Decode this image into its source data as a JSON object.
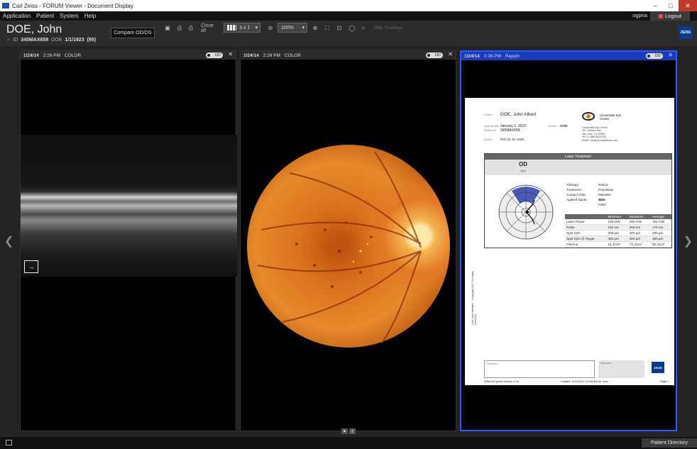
{
  "window": {
    "title": "Carl Zeiss - FORUM Viewer - Document Display",
    "minimize": "–",
    "maximize": "□",
    "close": "✕"
  },
  "menu": {
    "items": [
      "Application",
      "Patient",
      "System",
      "Help"
    ],
    "user": "ogpna",
    "logout": "Logout"
  },
  "patient": {
    "name": "DOE, John",
    "id_label": "ID",
    "id": "345MAX658",
    "dob_label": "DOB",
    "dob": "1/1/1923",
    "age": "(95)"
  },
  "toolbar": {
    "compare": "Compare OD/OS",
    "close_all": "Close all",
    "layout": "3 x 1",
    "zoom": "100%",
    "hide_overlays": "Hide Overlays"
  },
  "panels": [
    {
      "date": "1/24/14",
      "time": "2:26 PM",
      "type": "COLOR",
      "eye": "OD",
      "close": "✕"
    },
    {
      "date": "1/24/14",
      "time": "2:26 PM",
      "type": "COLOR",
      "eye": "OD",
      "close": "✕"
    },
    {
      "date": "1/24/14",
      "time": "2:26 PM",
      "type": "Report",
      "eye": "OD",
      "close": "✕"
    }
  ],
  "report": {
    "patient_label": "Patient",
    "patient_name": "DOE, John Albert",
    "dob_label": "Date of Birth",
    "dob": "January 1, 1923",
    "id_label": "Patient ID",
    "id": "345MAX658",
    "sex_label": "Gender",
    "sex": "male",
    "doctor_label": "Doctor",
    "doctor": "Prof. Dr. Dr. Smith",
    "clinic_name": "Cloverdale Eye Center",
    "clinic_address": [
      "Cloverdale Eye Center",
      "467 Jackson Ave",
      "San Jose, CA 95064",
      "Tel: +1-888-664-6782",
      "Email: info@cloverdaleeye.com"
    ],
    "section_title": "Laser Treatment",
    "eye": "OD",
    "eye_sub": "right",
    "params": [
      {
        "k": "Therapy:",
        "v": "Retina"
      },
      {
        "k": "Treatment:",
        "v": "Panretinal"
      },
      {
        "k": "Contact Glas:",
        "v": "Mainster Wide Field"
      },
      {
        "k": "Applied Spots:",
        "v": "124"
      }
    ],
    "table_headers": [
      "",
      "Minimum",
      "Maximum",
      "Average"
    ],
    "table_rows": [
      [
        "Laser Power",
        "130 mW",
        "260 mW",
        "191 mW"
      ],
      [
        "Pulse",
        "130 ms",
        "200 ms",
        "178 ms"
      ],
      [
        "Spot Size",
        "200 µm",
        "200 µm",
        "200 µm"
      ],
      [
        "Spot Size @ Target",
        "300 µm",
        "300 µm",
        "300 µm"
      ],
      [
        "Fluence",
        "14 J/cm²",
        "74 J/cm²",
        "50 J/cm²"
      ]
    ],
    "comment_label": "Comment:",
    "signature_label": "Signature:",
    "footer_left": "VISULAS green   Version 1.31",
    "footer_mid": "Created: 01/01/2017 10:05 AM by: Dom",
    "footer_right": "Page 1",
    "vertical_text": "Carl Zeiss Meditec - Copyright 2017 All rights reserved",
    "zeiss": "ZEISS"
  },
  "statusbar": {
    "patient_directory": "Patient Directory"
  },
  "brand": {
    "zeiss": "ZEISS",
    "accent": "#2a5cff"
  }
}
